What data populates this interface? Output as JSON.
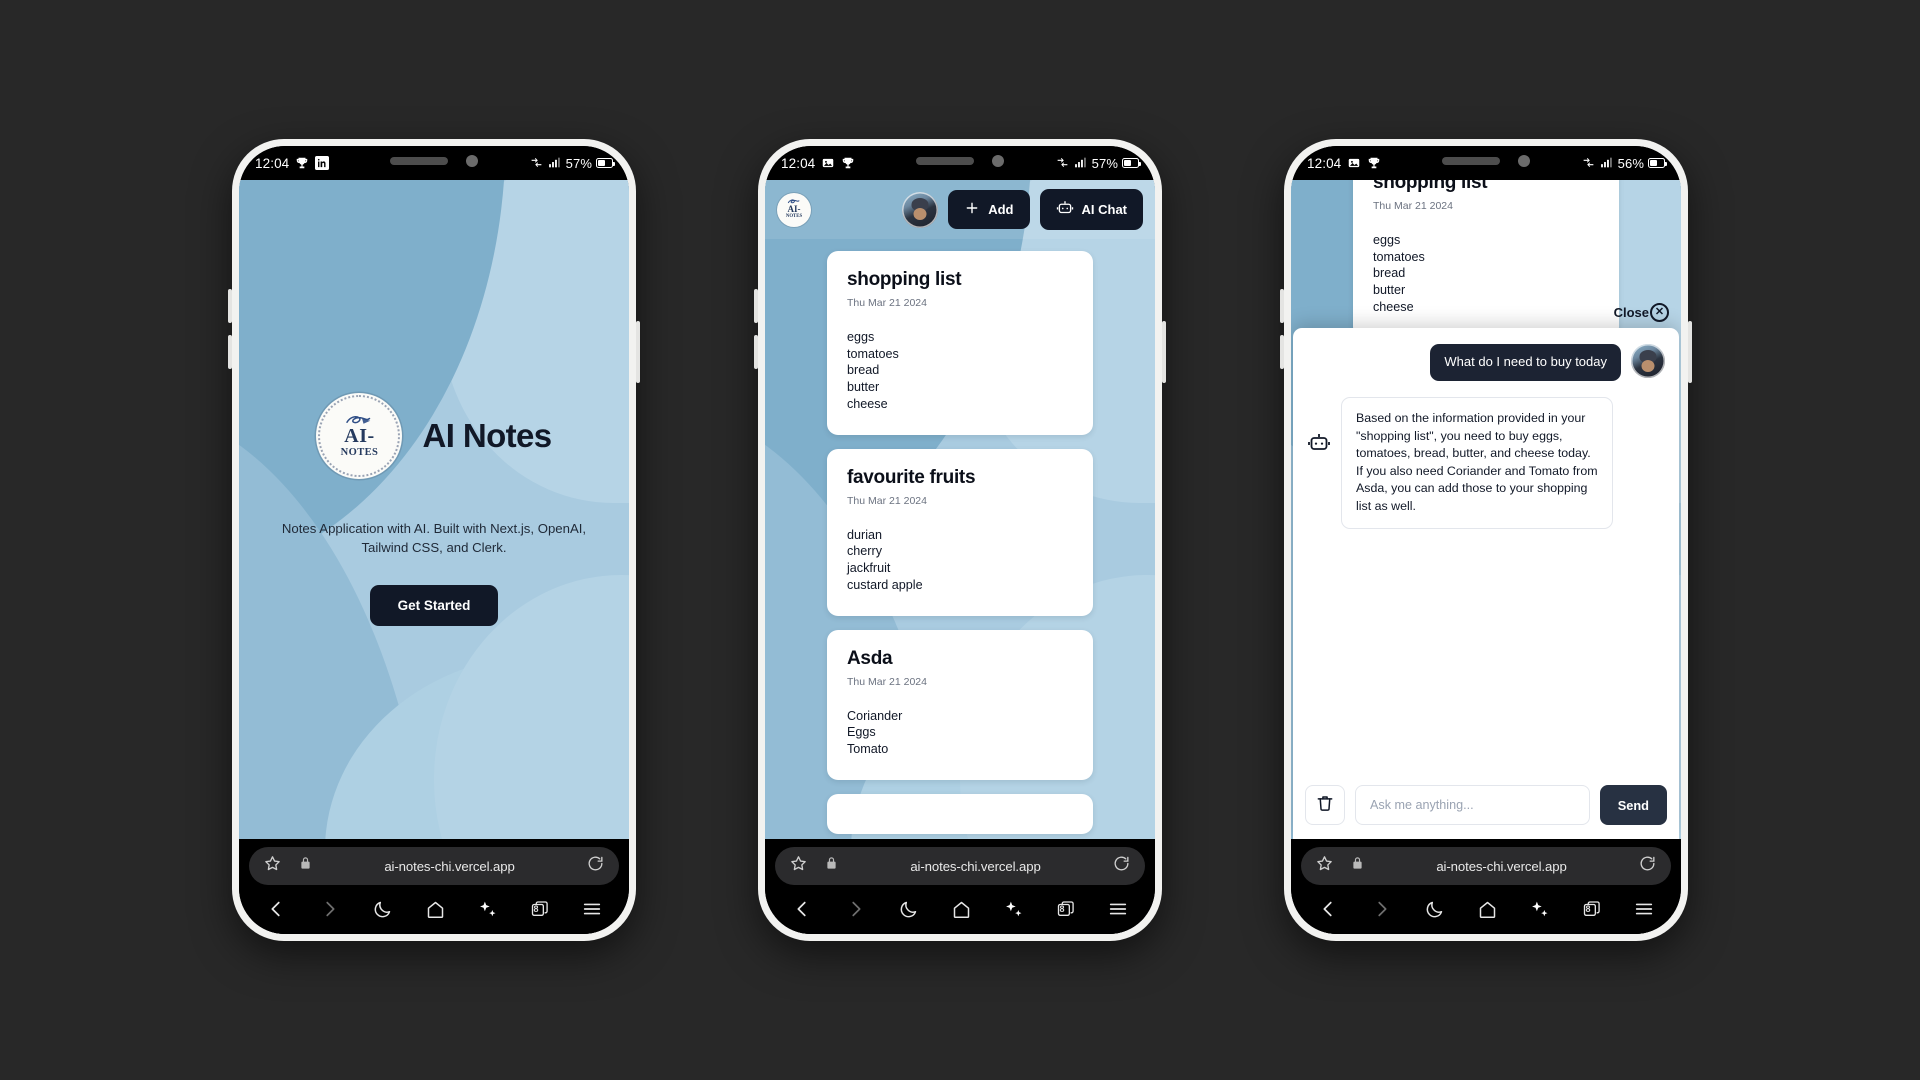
{
  "theme": {
    "accent_dark": "#111827",
    "wallpaper_blue": "#a9cbe0",
    "card_white": "#ffffff",
    "status_black": "#000000"
  },
  "phones": [
    {
      "id": "phone-landing",
      "status_bar": {
        "time": "12:04",
        "left_icons": [
          "trophy-icon",
          "linkedin-icon"
        ],
        "right_icons": [
          "wifi-transfer-icon",
          "signal-bars-icon"
        ],
        "battery_percent": "57%",
        "battery_level": 57
      },
      "screen": "landing",
      "landing": {
        "logo_line1": "AI-",
        "logo_line2": "NOTES",
        "title": "AI Notes",
        "subtitle": "Notes Application with AI. Built with Next.js, OpenAI, Tailwind CSS, and Clerk.",
        "cta_label": "Get Started"
      },
      "browser": {
        "url": "ai-notes-chi.vercel.app",
        "star_icon": "bookmark-star-icon",
        "lock_icon": "padlock-icon",
        "reload_icon": "reload-icon",
        "nav": {
          "back": "back-arrow-icon",
          "forward": "forward-arrow-icon",
          "dark_mode": "moon-icon",
          "home": "home-icon",
          "ai": "sparkles-icon",
          "tabs_count": "8",
          "menu": "hamburger-menu-icon"
        }
      }
    },
    {
      "id": "phone-notes",
      "status_bar": {
        "time": "12:04",
        "left_icons": [
          "image-icon",
          "trophy-icon"
        ],
        "right_icons": [
          "wifi-transfer-icon",
          "signal-bars-icon"
        ],
        "battery_percent": "57%",
        "battery_level": 57
      },
      "screen": "notes-list",
      "header": {
        "logo_line1": "AI-",
        "logo_line2": "NOTES",
        "avatar_label": "user-avatar",
        "add_label": "Add",
        "add_icon": "plus-icon",
        "chat_label": "AI Chat",
        "chat_icon": "robot-icon"
      },
      "notes": [
        {
          "title": "shopping list",
          "date": "Thu Mar 21 2024",
          "body": "eggs\ntomatoes\nbread\nbutter\ncheese"
        },
        {
          "title": "favourite fruits",
          "date": "Thu Mar 21 2024",
          "body": "durian\ncherry\njackfruit\ncustard apple"
        },
        {
          "title": "Asda",
          "date": "Thu Mar 21 2024",
          "body": "Coriander\nEggs\nTomato"
        }
      ],
      "browser": {
        "url": "ai-notes-chi.vercel.app",
        "star_icon": "bookmark-star-icon",
        "lock_icon": "padlock-icon",
        "reload_icon": "reload-icon",
        "nav": {
          "back": "back-arrow-icon",
          "forward": "forward-arrow-icon",
          "dark_mode": "moon-icon",
          "home": "home-icon",
          "ai": "sparkles-icon",
          "tabs_count": "8",
          "menu": "hamburger-menu-icon"
        }
      }
    },
    {
      "id": "phone-chat",
      "status_bar": {
        "time": "12:04",
        "left_icons": [
          "image-icon",
          "trophy-icon"
        ],
        "right_icons": [
          "wifi-transfer-icon",
          "signal-bars-icon"
        ],
        "battery_percent": "56%",
        "battery_level": 56
      },
      "screen": "ai-chat",
      "background_note": {
        "title": "shopping list",
        "date": "Thu Mar 21 2024",
        "body": "eggs\ntomatoes\nbread\nbutter\ncheese"
      },
      "chat": {
        "close_label": "Close",
        "close_icon": "close-circle-icon",
        "bot_icon": "robot-icon",
        "messages": [
          {
            "role": "user",
            "text": "What do I need to buy today"
          },
          {
            "role": "assistant",
            "text": "Based on the information provided in your \"shopping list\", you need to buy eggs, tomatoes, bread, butter, and cheese today. If you also need Coriander and Tomato from Asda, you can add those to your shopping list as well."
          }
        ],
        "input_placeholder": "Ask me anything...",
        "input_value": "",
        "clear_icon": "trash-icon",
        "send_label": "Send"
      },
      "browser": {
        "url": "ai-notes-chi.vercel.app",
        "star_icon": "bookmark-star-icon",
        "lock_icon": "padlock-icon",
        "reload_icon": "reload-icon",
        "nav": {
          "back": "back-arrow-icon",
          "forward": "forward-arrow-icon",
          "dark_mode": "moon-icon",
          "home": "home-icon",
          "ai": "sparkles-icon",
          "tabs_count": "8",
          "menu": "hamburger-menu-icon"
        }
      }
    }
  ]
}
